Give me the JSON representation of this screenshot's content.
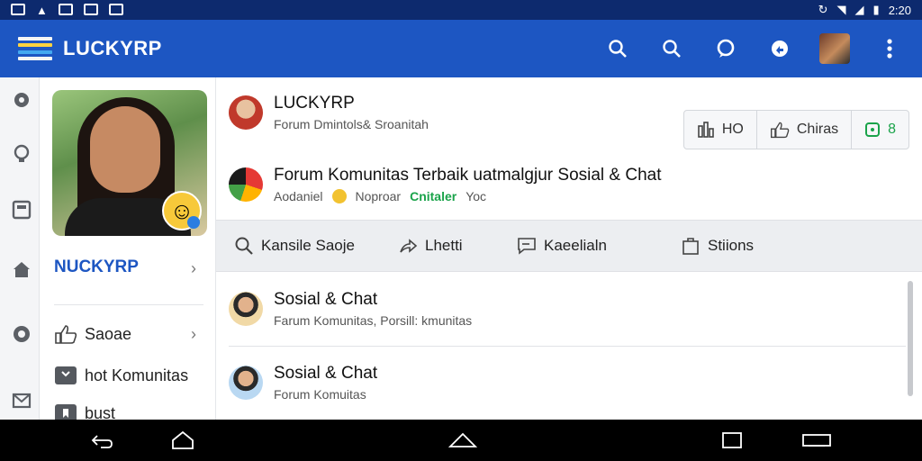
{
  "status_bar": {
    "time": "2:20"
  },
  "app": {
    "title": "LUCKYRP",
    "accent": "#1d56c2"
  },
  "sidebar": {
    "name": "NUCKYRP",
    "items": [
      {
        "label": "Saoae",
        "icon": "thumbs-up-icon"
      },
      {
        "label": "hot Komunitas",
        "icon": "video-icon"
      },
      {
        "label": "bust",
        "icon": "bookmark-icon"
      }
    ]
  },
  "header_post": {
    "title": "LUCKYRP",
    "subtitle": "Forum Dmintols& Sroanitah"
  },
  "stats": [
    {
      "label": "HO",
      "icon": "chart-icon"
    },
    {
      "label": "Chiras",
      "icon": "thumbs-up-icon"
    },
    {
      "label": "8",
      "icon": "square-icon"
    }
  ],
  "forum_post": {
    "title": "Forum Komunitas Terbaik uatmalgjur Sosial & Chat",
    "meta": [
      "Aodaniel",
      "Noproar",
      "Cnitaler",
      "Yoc"
    ]
  },
  "actions": [
    {
      "label": "Kansile Saoje",
      "icon": "search-icon"
    },
    {
      "label": "Lhetti",
      "icon": "share-icon"
    },
    {
      "label": "Kaeelialn",
      "icon": "comment-icon"
    },
    {
      "label": "Stiions",
      "icon": "bag-icon"
    }
  ],
  "feed": [
    {
      "title": "Sosial & Chat",
      "subtitle": "Farum Komunitas, Porsill: kmunitas"
    },
    {
      "title": "Sosial & Chat",
      "subtitle": "Forum Komuitas"
    }
  ]
}
